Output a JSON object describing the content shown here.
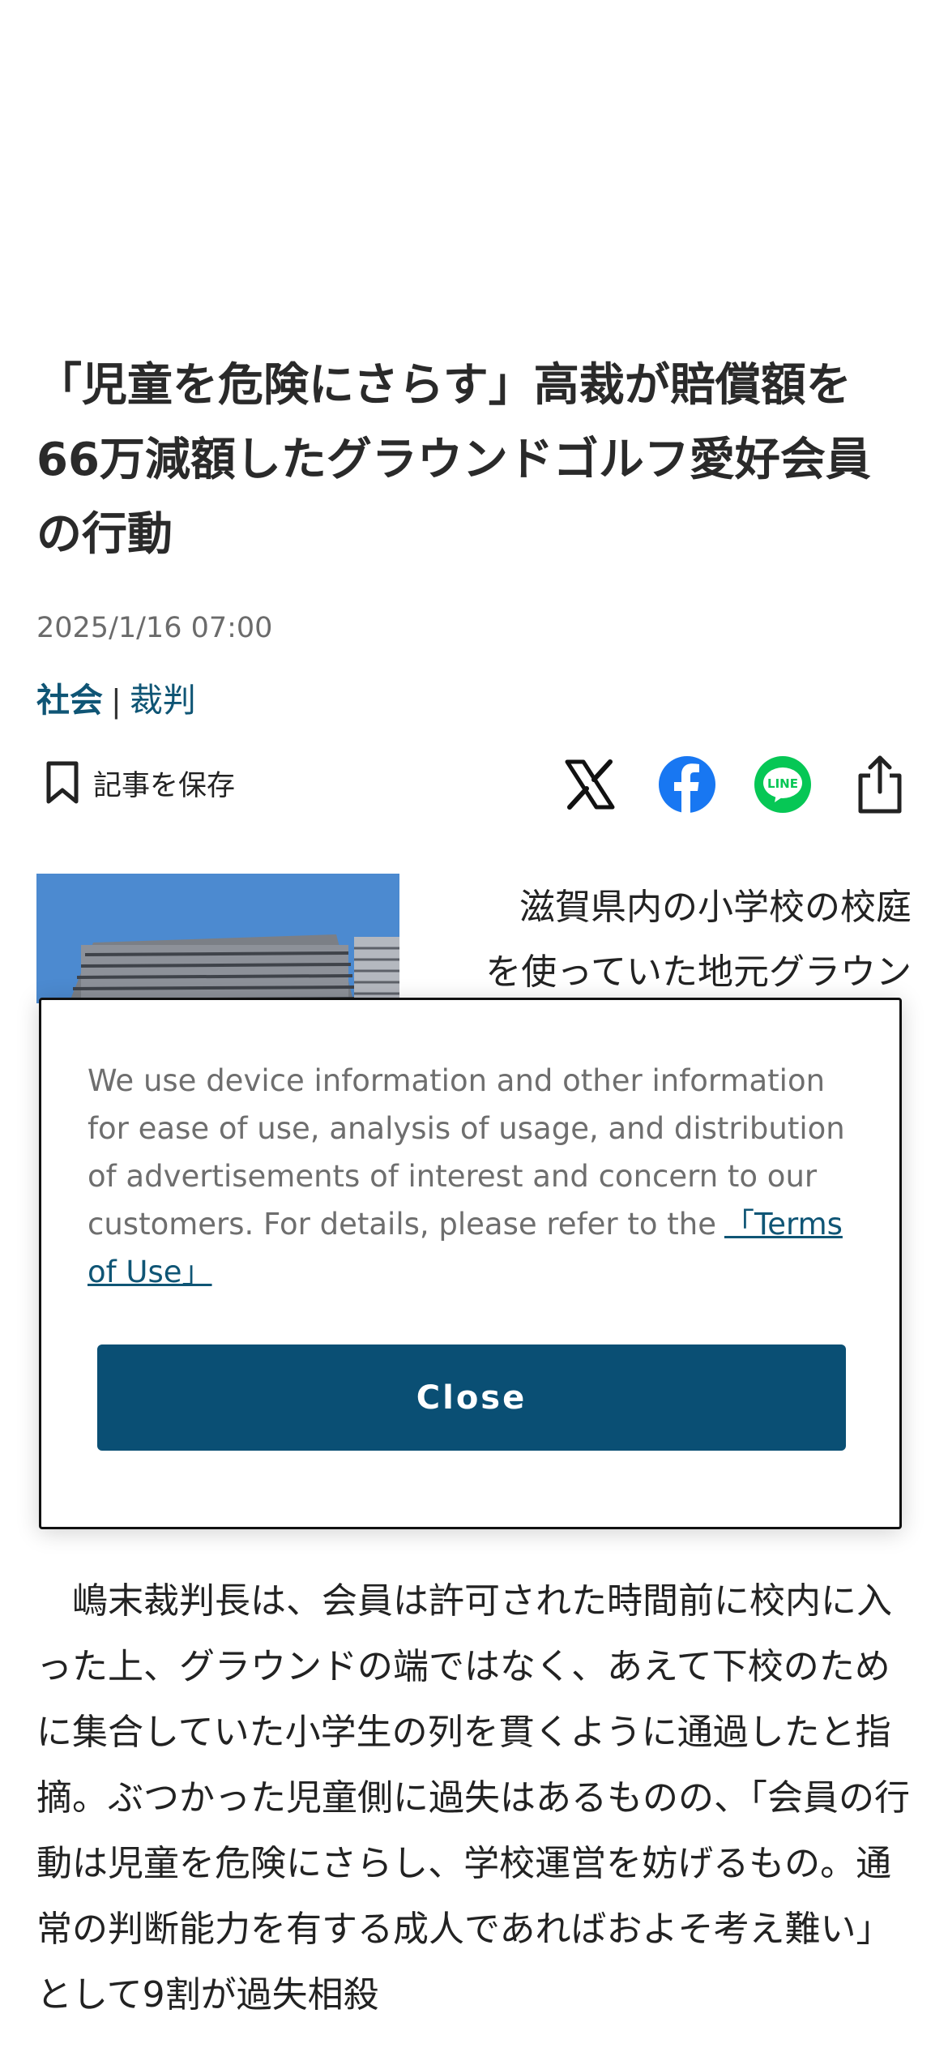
{
  "article": {
    "headline": "「児童を危険にさらす」高裁が賠償額を66万減額したグラウンドゴルフ愛好会員の行動",
    "date": "2025/1/16 07:00",
    "categories": [
      {
        "label": "社会"
      },
      {
        "label": "裁判"
      }
    ],
    "separator": "|",
    "intro_lines": [
      "滋賀県内の小学校の校庭",
      "を使っていた地元グラウン"
    ],
    "body": "　嶋末裁判長は、会員は許可された時間前に校内に入った上、グラウンドの端ではなく、あえて下校のために集合していた小学生の列を貫くように通過したと指摘。ぶつかった児童側に過失はあるものの、「会員の行動は児童を危険にさらし、学校運営を妨げるもの。通常の判断能力を有する成人であればおよそ考え難い」として9割が過失相殺"
  },
  "toolbar": {
    "save_label": "記事を保存",
    "line_icon_text": "LINE"
  },
  "colors": {
    "accent": "#0a4f74",
    "link": "#0f5575",
    "x": "#111111",
    "facebook": "#1877f2",
    "line": "#06c755"
  },
  "icons": {
    "save": "bookmark-icon",
    "x": "x-logo-icon",
    "facebook": "facebook-icon",
    "line": "line-icon",
    "share": "share-icon"
  },
  "consent": {
    "text": "We use device information and other information for ease of use, analysis of usage, and distribution of advertisements of interest and concern to our customers. For details, please refer to the",
    "link_label": "「Terms of Use」",
    "close_label": "Close"
  }
}
